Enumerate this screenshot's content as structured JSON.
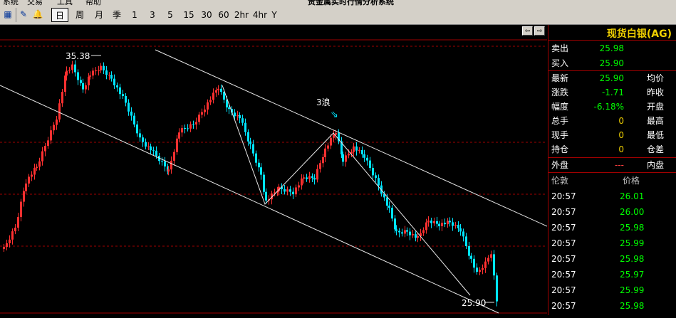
{
  "app": {
    "title": "贵金属实时行情分析系统",
    "menu": [
      "系统",
      "交易",
      "工具",
      "帮助"
    ]
  },
  "toolbar": {
    "periods": [
      "日",
      "周",
      "月",
      "季",
      "1",
      "3",
      "5",
      "15",
      "30",
      "60",
      "2hr",
      "4hr",
      "Y"
    ],
    "active_period": "日"
  },
  "chart": {
    "high_label": "35.38",
    "low_label": "25.90",
    "wave_label": "3浪",
    "up_color": "#ff3030",
    "down_color": "#00e5ff",
    "grid_color": "#a00000"
  },
  "quote": {
    "symbol": "现货白银(AG)",
    "rows": [
      {
        "label": "卖出",
        "value": "25.98",
        "label2": ""
      },
      {
        "label": "买入",
        "value": "25.90",
        "label2": ""
      },
      {
        "label": "最新",
        "value": "25.90",
        "label2": "均价"
      },
      {
        "label": "涨跌",
        "value": "-1.71",
        "label2": "昨收"
      },
      {
        "label": "幅度",
        "value": "-6.18%",
        "label2": "开盘"
      },
      {
        "label": "总手",
        "value": "0",
        "label2": "最高"
      },
      {
        "label": "现手",
        "value": "0",
        "label2": "最低"
      },
      {
        "label": "持仓",
        "value": "0",
        "label2": "仓差"
      },
      {
        "label": "外盘",
        "value": "---",
        "label2": "内盘"
      }
    ]
  },
  "ticks": {
    "col_time": "伦敦",
    "col_price": "价格",
    "rows": [
      {
        "time": "20:57",
        "price": "26.01"
      },
      {
        "time": "20:57",
        "price": "26.00"
      },
      {
        "time": "20:57",
        "price": "25.98"
      },
      {
        "time": "20:57",
        "price": "25.99"
      },
      {
        "time": "20:57",
        "price": "25.98"
      },
      {
        "time": "20:57",
        "price": "25.97"
      },
      {
        "time": "20:57",
        "price": "25.99"
      },
      {
        "time": "20:57",
        "price": "25.98"
      }
    ]
  }
}
